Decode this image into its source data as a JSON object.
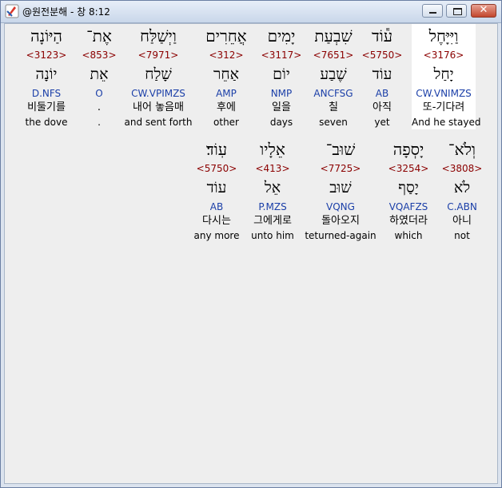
{
  "window": {
    "title": "@원전분해 - 창 8:12",
    "buttons": {
      "minimize": "—",
      "maximize": "□",
      "close": "✕"
    }
  },
  "rows": [
    [
      {
        "hebrew": "וַיִּיָּחֶל",
        "strong": "<3176>",
        "lemma": "יָחַל",
        "parse": "CW.VNIMZS",
        "korean": "또-기다려",
        "english": "And he stayed",
        "highlight": true
      },
      {
        "hebrew": "ע֕וֹד",
        "strong": "<5750>",
        "lemma": "עוֹד",
        "parse": "AB",
        "korean": "아직",
        "english": "yet"
      },
      {
        "hebrew": "שִׁבְעַת",
        "strong": "<7651>",
        "lemma": "שֶׁבַע",
        "parse": "ANCFSG",
        "korean": "칠",
        "english": "seven"
      },
      {
        "hebrew": "יָמִים",
        "strong": "<3117>",
        "lemma": "יוֹם",
        "parse": "NMP",
        "korean": "일을",
        "english": "days"
      },
      {
        "hebrew": "אֲחֵרִים",
        "strong": "<312>",
        "lemma": "אַחֵר",
        "parse": "AMP",
        "korean": "후에",
        "english": "other"
      },
      {
        "hebrew": "וַיְשַׁלַּח",
        "strong": "<7971>",
        "lemma": "שָׁלַח",
        "parse": "CW.VPIMZS",
        "korean": "내어 놓음매",
        "english": "and sent forth"
      },
      {
        "hebrew": "אֶת־",
        "strong": "<853>",
        "lemma": "אֵת",
        "parse": "O",
        "korean": ".",
        "english": "."
      },
      {
        "hebrew": "הַיּוֹנָה",
        "strong": "<3123>",
        "lemma": "יוֹנָה",
        "parse": "D.NFS",
        "korean": "비둘기를",
        "english": "the dove"
      }
    ],
    [
      {
        "hebrew": "וְלֹא־",
        "strong": "<3808>",
        "lemma": "לֹא",
        "parse": "C.ABN",
        "korean": "아니",
        "english": "not"
      },
      {
        "hebrew": "יָסְפָה",
        "strong": "<3254>",
        "lemma": "יָסַף",
        "parse": "VQAFZS",
        "korean": "하였더라",
        "english": "which"
      },
      {
        "hebrew": "שׁוּב־",
        "strong": "<7725>",
        "lemma": "שׁוּב",
        "parse": "VQNG",
        "korean": "돌아오지",
        "english": "teturned-again"
      },
      {
        "hebrew": "אֵלָיו",
        "strong": "<413>",
        "lemma": "אֵל",
        "parse": "P.MZS",
        "korean": "그에게로",
        "english": "unto him"
      },
      {
        "hebrew": "עֽוֹד׃",
        "strong": "<5750>",
        "lemma": "עוֹד",
        "parse": "AB",
        "korean": "다시는",
        "english": "any more"
      }
    ]
  ]
}
